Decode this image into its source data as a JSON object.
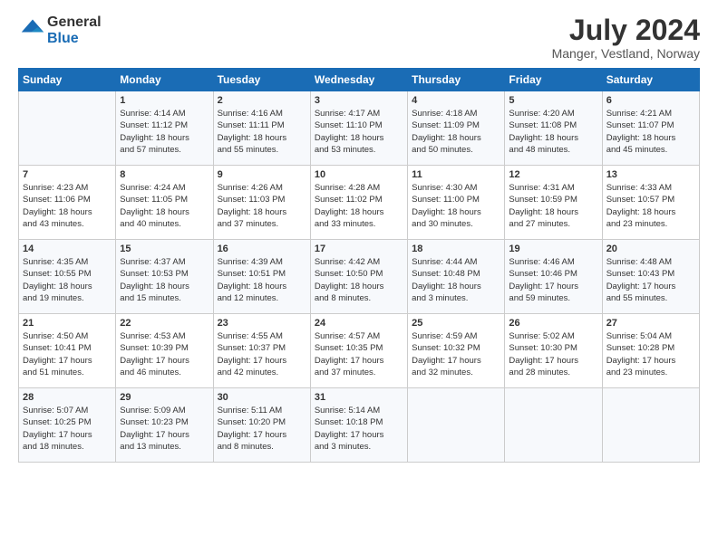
{
  "header": {
    "logo_line1": "General",
    "logo_line2": "Blue",
    "month_title": "July 2024",
    "location": "Manger, Vestland, Norway"
  },
  "days_of_week": [
    "Sunday",
    "Monday",
    "Tuesday",
    "Wednesday",
    "Thursday",
    "Friday",
    "Saturday"
  ],
  "weeks": [
    [
      {
        "day": "",
        "lines": []
      },
      {
        "day": "1",
        "lines": [
          "Sunrise: 4:14 AM",
          "Sunset: 11:12 PM",
          "Daylight: 18 hours",
          "and 57 minutes."
        ]
      },
      {
        "day": "2",
        "lines": [
          "Sunrise: 4:16 AM",
          "Sunset: 11:11 PM",
          "Daylight: 18 hours",
          "and 55 minutes."
        ]
      },
      {
        "day": "3",
        "lines": [
          "Sunrise: 4:17 AM",
          "Sunset: 11:10 PM",
          "Daylight: 18 hours",
          "and 53 minutes."
        ]
      },
      {
        "day": "4",
        "lines": [
          "Sunrise: 4:18 AM",
          "Sunset: 11:09 PM",
          "Daylight: 18 hours",
          "and 50 minutes."
        ]
      },
      {
        "day": "5",
        "lines": [
          "Sunrise: 4:20 AM",
          "Sunset: 11:08 PM",
          "Daylight: 18 hours",
          "and 48 minutes."
        ]
      },
      {
        "day": "6",
        "lines": [
          "Sunrise: 4:21 AM",
          "Sunset: 11:07 PM",
          "Daylight: 18 hours",
          "and 45 minutes."
        ]
      }
    ],
    [
      {
        "day": "7",
        "lines": [
          "Sunrise: 4:23 AM",
          "Sunset: 11:06 PM",
          "Daylight: 18 hours",
          "and 43 minutes."
        ]
      },
      {
        "day": "8",
        "lines": [
          "Sunrise: 4:24 AM",
          "Sunset: 11:05 PM",
          "Daylight: 18 hours",
          "and 40 minutes."
        ]
      },
      {
        "day": "9",
        "lines": [
          "Sunrise: 4:26 AM",
          "Sunset: 11:03 PM",
          "Daylight: 18 hours",
          "and 37 minutes."
        ]
      },
      {
        "day": "10",
        "lines": [
          "Sunrise: 4:28 AM",
          "Sunset: 11:02 PM",
          "Daylight: 18 hours",
          "and 33 minutes."
        ]
      },
      {
        "day": "11",
        "lines": [
          "Sunrise: 4:30 AM",
          "Sunset: 11:00 PM",
          "Daylight: 18 hours",
          "and 30 minutes."
        ]
      },
      {
        "day": "12",
        "lines": [
          "Sunrise: 4:31 AM",
          "Sunset: 10:59 PM",
          "Daylight: 18 hours",
          "and 27 minutes."
        ]
      },
      {
        "day": "13",
        "lines": [
          "Sunrise: 4:33 AM",
          "Sunset: 10:57 PM",
          "Daylight: 18 hours",
          "and 23 minutes."
        ]
      }
    ],
    [
      {
        "day": "14",
        "lines": [
          "Sunrise: 4:35 AM",
          "Sunset: 10:55 PM",
          "Daylight: 18 hours",
          "and 19 minutes."
        ]
      },
      {
        "day": "15",
        "lines": [
          "Sunrise: 4:37 AM",
          "Sunset: 10:53 PM",
          "Daylight: 18 hours",
          "and 15 minutes."
        ]
      },
      {
        "day": "16",
        "lines": [
          "Sunrise: 4:39 AM",
          "Sunset: 10:51 PM",
          "Daylight: 18 hours",
          "and 12 minutes."
        ]
      },
      {
        "day": "17",
        "lines": [
          "Sunrise: 4:42 AM",
          "Sunset: 10:50 PM",
          "Daylight: 18 hours",
          "and 8 minutes."
        ]
      },
      {
        "day": "18",
        "lines": [
          "Sunrise: 4:44 AM",
          "Sunset: 10:48 PM",
          "Daylight: 18 hours",
          "and 3 minutes."
        ]
      },
      {
        "day": "19",
        "lines": [
          "Sunrise: 4:46 AM",
          "Sunset: 10:46 PM",
          "Daylight: 17 hours",
          "and 59 minutes."
        ]
      },
      {
        "day": "20",
        "lines": [
          "Sunrise: 4:48 AM",
          "Sunset: 10:43 PM",
          "Daylight: 17 hours",
          "and 55 minutes."
        ]
      }
    ],
    [
      {
        "day": "21",
        "lines": [
          "Sunrise: 4:50 AM",
          "Sunset: 10:41 PM",
          "Daylight: 17 hours",
          "and 51 minutes."
        ]
      },
      {
        "day": "22",
        "lines": [
          "Sunrise: 4:53 AM",
          "Sunset: 10:39 PM",
          "Daylight: 17 hours",
          "and 46 minutes."
        ]
      },
      {
        "day": "23",
        "lines": [
          "Sunrise: 4:55 AM",
          "Sunset: 10:37 PM",
          "Daylight: 17 hours",
          "and 42 minutes."
        ]
      },
      {
        "day": "24",
        "lines": [
          "Sunrise: 4:57 AM",
          "Sunset: 10:35 PM",
          "Daylight: 17 hours",
          "and 37 minutes."
        ]
      },
      {
        "day": "25",
        "lines": [
          "Sunrise: 4:59 AM",
          "Sunset: 10:32 PM",
          "Daylight: 17 hours",
          "and 32 minutes."
        ]
      },
      {
        "day": "26",
        "lines": [
          "Sunrise: 5:02 AM",
          "Sunset: 10:30 PM",
          "Daylight: 17 hours",
          "and 28 minutes."
        ]
      },
      {
        "day": "27",
        "lines": [
          "Sunrise: 5:04 AM",
          "Sunset: 10:28 PM",
          "Daylight: 17 hours",
          "and 23 minutes."
        ]
      }
    ],
    [
      {
        "day": "28",
        "lines": [
          "Sunrise: 5:07 AM",
          "Sunset: 10:25 PM",
          "Daylight: 17 hours",
          "and 18 minutes."
        ]
      },
      {
        "day": "29",
        "lines": [
          "Sunrise: 5:09 AM",
          "Sunset: 10:23 PM",
          "Daylight: 17 hours",
          "and 13 minutes."
        ]
      },
      {
        "day": "30",
        "lines": [
          "Sunrise: 5:11 AM",
          "Sunset: 10:20 PM",
          "Daylight: 17 hours",
          "and 8 minutes."
        ]
      },
      {
        "day": "31",
        "lines": [
          "Sunrise: 5:14 AM",
          "Sunset: 10:18 PM",
          "Daylight: 17 hours",
          "and 3 minutes."
        ]
      },
      {
        "day": "",
        "lines": []
      },
      {
        "day": "",
        "lines": []
      },
      {
        "day": "",
        "lines": []
      }
    ]
  ]
}
